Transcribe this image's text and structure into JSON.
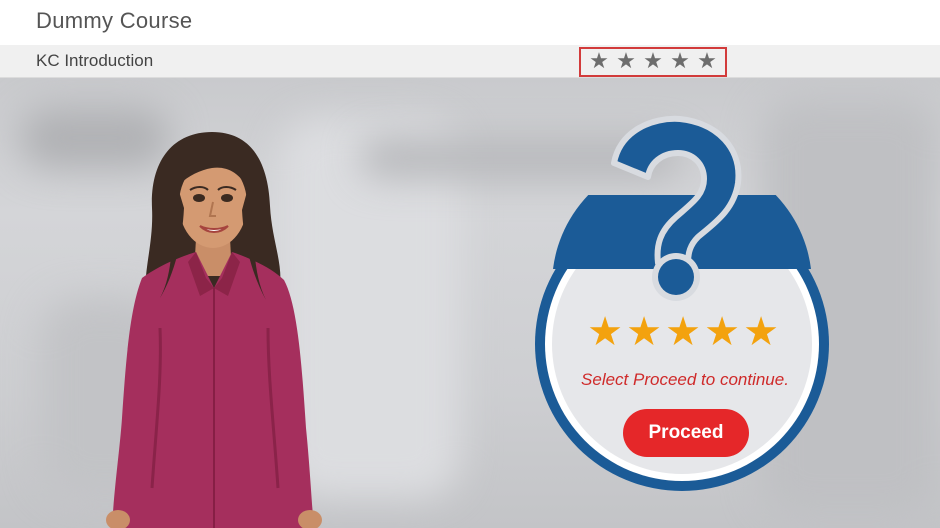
{
  "course": {
    "title": "Dummy Course"
  },
  "lesson": {
    "title": "KC Introduction"
  },
  "rating": {
    "stars": [
      "★",
      "★",
      "★",
      "★",
      "★"
    ],
    "star_icon": "star-icon",
    "box_color": "#d23b3b",
    "star_color": "#6d6d6d"
  },
  "card": {
    "icon": "question-mark-icon",
    "stars": [
      "★",
      "★",
      "★",
      "★",
      "★"
    ],
    "star_color": "#f3a20e",
    "message": "Select Proceed to continue.",
    "proceed_label": "Proceed",
    "accent": "#e52729",
    "brand_blue": "#1b5b97"
  },
  "character": {
    "icon": "presenter-character"
  }
}
